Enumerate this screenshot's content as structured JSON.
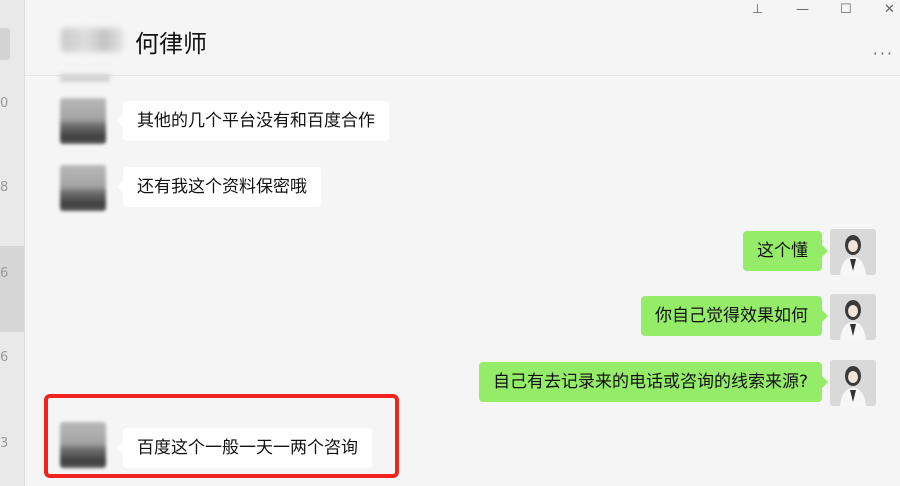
{
  "window": {
    "controls": {
      "pin": "⊥",
      "minimize": "—",
      "maximize": "☐",
      "close": "✕"
    }
  },
  "sidebar_strip": {
    "numbers": [
      "0",
      "8",
      "6",
      "6",
      "3"
    ]
  },
  "chat": {
    "contact_name": "何律师",
    "more_label": "···"
  },
  "messages": [
    {
      "side": "in",
      "text": "其他的几个平台没有和百度合作"
    },
    {
      "side": "in",
      "text": "还有我这个资料保密哦"
    },
    {
      "side": "out",
      "text": "这个懂"
    },
    {
      "side": "out",
      "text": "你自己觉得效果如何"
    },
    {
      "side": "out",
      "text": "自己有去记录来的电话或咨询的线索来源?"
    },
    {
      "side": "in",
      "text": "百度这个一般一天一两个咨询",
      "highlighted": true
    }
  ],
  "colors": {
    "outgoing_bubble": "#95ec69",
    "incoming_bubble": "#ffffff",
    "highlight_border": "#f0221e",
    "background": "#f5f5f5"
  }
}
